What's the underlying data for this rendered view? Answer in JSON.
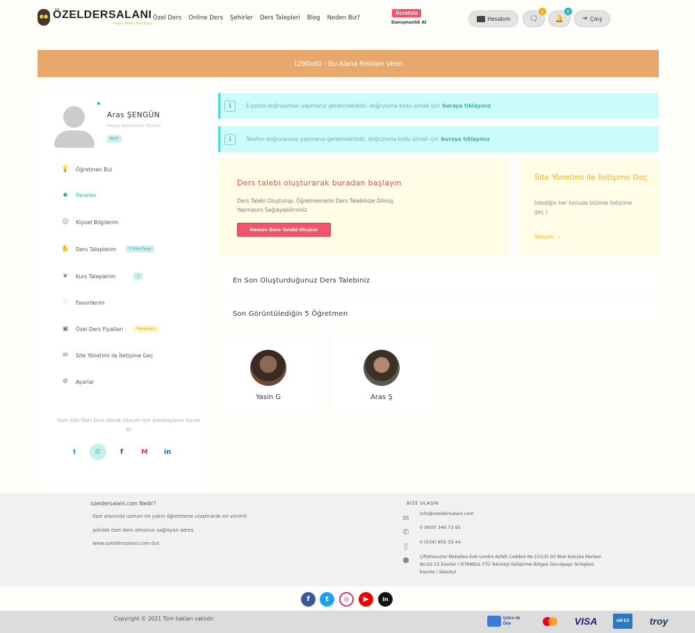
{
  "header": {
    "logo_title": "ÖZELDERSALANI",
    "logo_sub": "Arayın, Bulun, Ders Başa",
    "nav": [
      "Özel Ders",
      "Online Ders",
      "Şehirler",
      "Ders Talepleri",
      "Blog",
      "Neden Biz?"
    ],
    "free_badge": "Ücretsiz",
    "free_sub": "Danışmanlık Al",
    "account_label": "Hesabım",
    "messages_count": "1",
    "notifications_count": "0",
    "logout_label": "Çıkış"
  },
  "ad_banner": "1290x60 - Bu Alana Reklam Verin",
  "profile": {
    "name": "Aras ŞENGÜN",
    "role": "Hesap Ayarlarınızı Yönetin",
    "badge": "Aktif"
  },
  "menu": [
    {
      "label": "Öğretmen Bul",
      "icon": "lightbulb-icon",
      "badge": ""
    },
    {
      "label": "Panelim",
      "icon": "diamond-icon",
      "badge": "",
      "active": true
    },
    {
      "label": "Kişisel Bilgilerim",
      "icon": "user-icon",
      "badge": ""
    },
    {
      "label": "Ders Taleplerim",
      "icon": "hand-icon",
      "badge": "0 Adet Talep"
    },
    {
      "label": "Kurs Taleplerim",
      "icon": "bulb-icon",
      "badge": "1"
    },
    {
      "label": "Favorilerim",
      "icon": "heart-icon",
      "badge": ""
    },
    {
      "label": "Özel Ders Fiyatları",
      "icon": "price-icon",
      "badge": "Hesaplayın"
    },
    {
      "label": "Site Yönetimi ile İletişime Geç",
      "icon": "mail-icon",
      "badge": ""
    },
    {
      "label": "Ayarlar",
      "icon": "gear-icon",
      "badge": ""
    }
  ],
  "sidebar_note": "Sizin Gibi Özel Ders Almak İsteyen İçin Arkadaşlarını Davet Et",
  "alerts": [
    {
      "text": "E-posta doğrulaması yapmanız gerekmektedir. doğrulama kodu almak için",
      "link": "buraya tıklayınız"
    },
    {
      "text": "Telefon doğrulaması yapmanız gerekmektedir. doğrulama kodu almak için",
      "link": "buraya tıklayınız"
    }
  ],
  "cta": {
    "title": "Ders talebi oluşturarak buradan başlayın",
    "desc": "Ders Talebi Oluşturup, Öğretmenlerin Ders Talebinize Dönüş Yapmasını Sağlayabilirsiniz",
    "button": "Hemen Ders Talebi Oluştur"
  },
  "contact_card": {
    "title": "Site Yönetimi ile İletişime Geç",
    "desc": "İstediğin her konuda bizimle iletişime geç !",
    "link": "İletişim"
  },
  "sections": {
    "last_request": "En Son Oluşturduğunuz Ders Talebiniz",
    "last_viewed": "Son Görüntülediğin 5 Öğretmen"
  },
  "teachers": [
    {
      "name": "Yasin G"
    },
    {
      "name": "Aras Ş"
    }
  ],
  "footer": {
    "about_title": "ozeldersalani.com Nedir?",
    "about_lines": [
      "Size alanında uzman en yakın öğretmene ulaştırarak en verimli",
      "şekilde özel ders almanızı sağlayan adres",
      "www.ozeldersalani.com dur."
    ],
    "contact_title": "BİZE ULAŞIN",
    "email": "info@ozeldersalani.com",
    "phone1": "0 (850) 346 73 95",
    "phone2": "0 (534) 855 33 44",
    "address": "Çiftehavuzlar Mahallesi Eski Londra Asfaltı Caddesi No:151/1F D2 Blok Kuluçka Merkezi No:D2 C2 Esenler / İSTANBUL YTÜ Teknoloji Geliştirme Bölgesi Davutpaşa Yerleşkesi Esenler / İstanbul",
    "copyright": "Copyright © 2021 Tüm hakları saklıdır.",
    "social": [
      "facebook-icon",
      "twitter-icon",
      "instagram-icon",
      "youtube-icon",
      "linkedin-icon"
    ],
    "payments": [
      "iyzico ile Öde",
      "Mastercard",
      "VISA",
      "American Express",
      "troy"
    ]
  },
  "colors": {
    "accent": "#f2556b",
    "ad": "#e9a86b",
    "alert": "#ccfbfc",
    "cta_bg": "#fffde6",
    "contact_title": "#f5b10f"
  }
}
